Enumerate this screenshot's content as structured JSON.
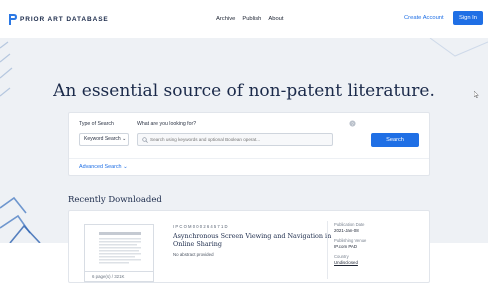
{
  "nav": {
    "logo_text": "PRIOR ART DATABASE",
    "links": [
      "Archive",
      "Publish",
      "About"
    ],
    "create_account": "Create Account",
    "sign_in": "Sign In"
  },
  "hero": {
    "headline": "An essential source of non-patent literature."
  },
  "search": {
    "type_label": "Type of Search",
    "query_label": "What are you looking for?",
    "type_value": "Keyword Search",
    "placeholder": "Search using keywords and optional Boolean operat...",
    "button": "Search",
    "advanced": "Advanced Search"
  },
  "recent": {
    "title": "Recently Downloaded",
    "item": {
      "id": "IPCOM000264571D",
      "title": "Asynchronous Screen Viewing and Navigation in Online Sharing",
      "abstract": "No abstract provided",
      "page_count": "6 page(s) / 321K",
      "publication_date_label": "Publication Date",
      "publication_date": "2021-Jan-08",
      "publishing_venue_label": "Publishing Venue",
      "publishing_venue": "IP.com PAD",
      "country_label": "Country",
      "country": "Undisclosed"
    }
  },
  "colors": {
    "primary": "#1f6fe5",
    "navy": "#1b2a4a",
    "hero_bg": "#eef1f5"
  }
}
